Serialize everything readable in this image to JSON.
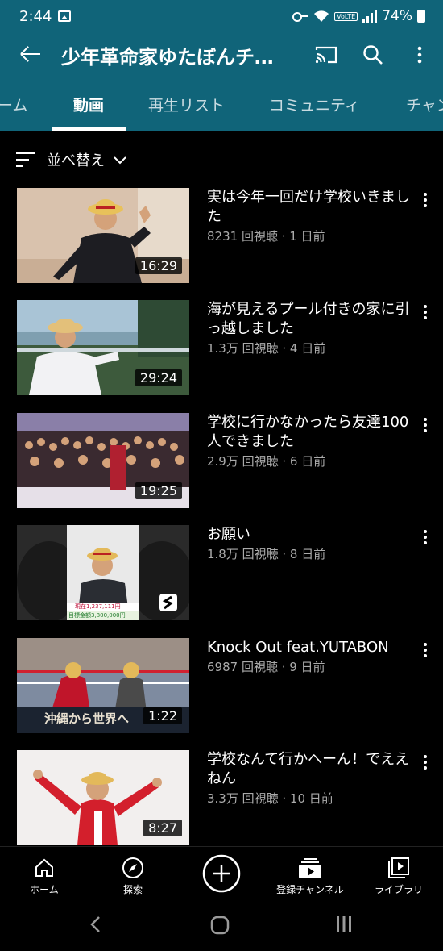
{
  "status_bar": {
    "time": "2:44",
    "battery": "74%",
    "volte": "VoLTE"
  },
  "app_bar": {
    "title": "少年革命家ゆたぼんチャンネル"
  },
  "tabs": [
    {
      "label": "ホーム"
    },
    {
      "label": "動画"
    },
    {
      "label": "再生リスト"
    },
    {
      "label": "コミュニティ"
    },
    {
      "label": "チャンネル"
    }
  ],
  "sort": {
    "label": "並べ替え"
  },
  "videos": [
    {
      "title": "実は今年一回だけ学校いきました",
      "meta": "8231 回視聴 · 1 日前",
      "duration": "16:29"
    },
    {
      "title": "海が見えるプール付きの家に引っ越しました",
      "meta": "1.3万 回視聴 · 4 日前",
      "duration": "29:24"
    },
    {
      "title": "学校に行かなかったら友達100人できました",
      "meta": "2.9万 回視聴 · 6 日前",
      "duration": "19:25"
    },
    {
      "title": "お願い",
      "meta": "1.8万 回視聴 · 8 日前",
      "duration": "",
      "thumb_text_1": "現在1,237,111円",
      "thumb_text_2": "目標金額3,800,000円"
    },
    {
      "title": "Knock Out feat.YUTABON",
      "meta": "6987 回視聴 · 9 日前",
      "duration": "1:22",
      "thumb_text": "沖縄から世界へ"
    },
    {
      "title": "学校なんて行かへーん！でええねん",
      "meta": "3.3万 回視聴 · 10 日前",
      "duration": "8:27"
    }
  ],
  "bottom_nav": [
    {
      "label": "ホーム"
    },
    {
      "label": "探索"
    },
    {
      "label": ""
    },
    {
      "label": "登録チャンネル"
    },
    {
      "label": "ライブラリ"
    }
  ],
  "colors": {
    "header": "#106479",
    "background": "#000000",
    "meta_text": "#aaaaaa"
  }
}
